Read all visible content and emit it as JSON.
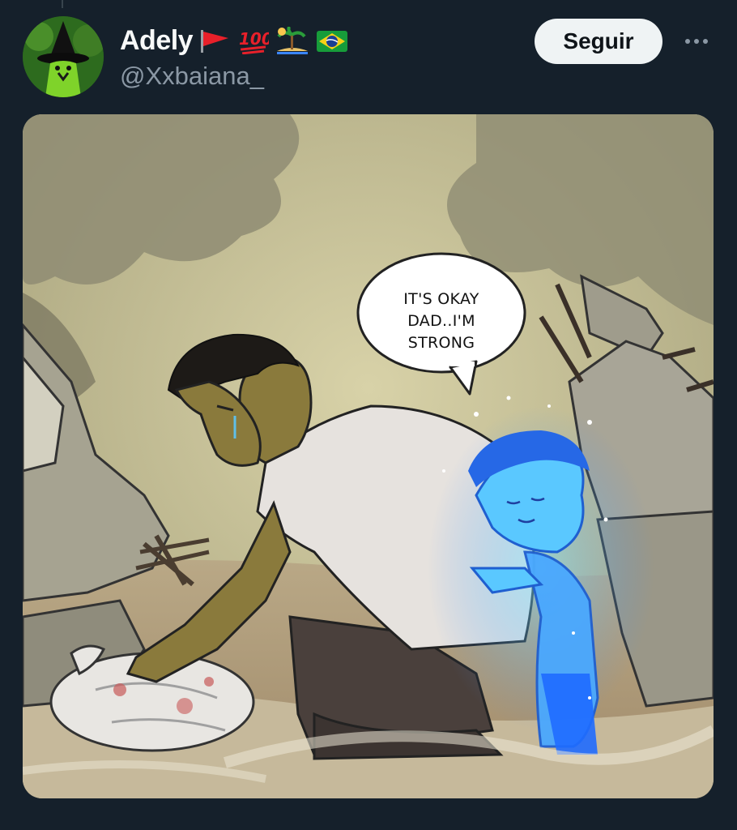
{
  "post": {
    "author": {
      "display_name": "Adely",
      "handle": "@Xxbaiana_",
      "name_emojis": [
        "red-flag-icon",
        "hundred-points-icon",
        "desert-island-icon",
        "brazil-flag-icon"
      ]
    },
    "follow_label": "Seguir",
    "more_icon": "ellipsis-icon",
    "media": {
      "speech_bubble_lines": [
        "IT'S OKAY",
        "DAD..I'M",
        "STRONG"
      ]
    }
  },
  "colors": {
    "background": "#15202b",
    "name_text": "#f7f9f9",
    "handle_text": "#8b98a5",
    "follow_button_bg": "#eff3f4",
    "follow_button_text": "#0f1419",
    "ghost_child_blue": "#3a8cff"
  }
}
